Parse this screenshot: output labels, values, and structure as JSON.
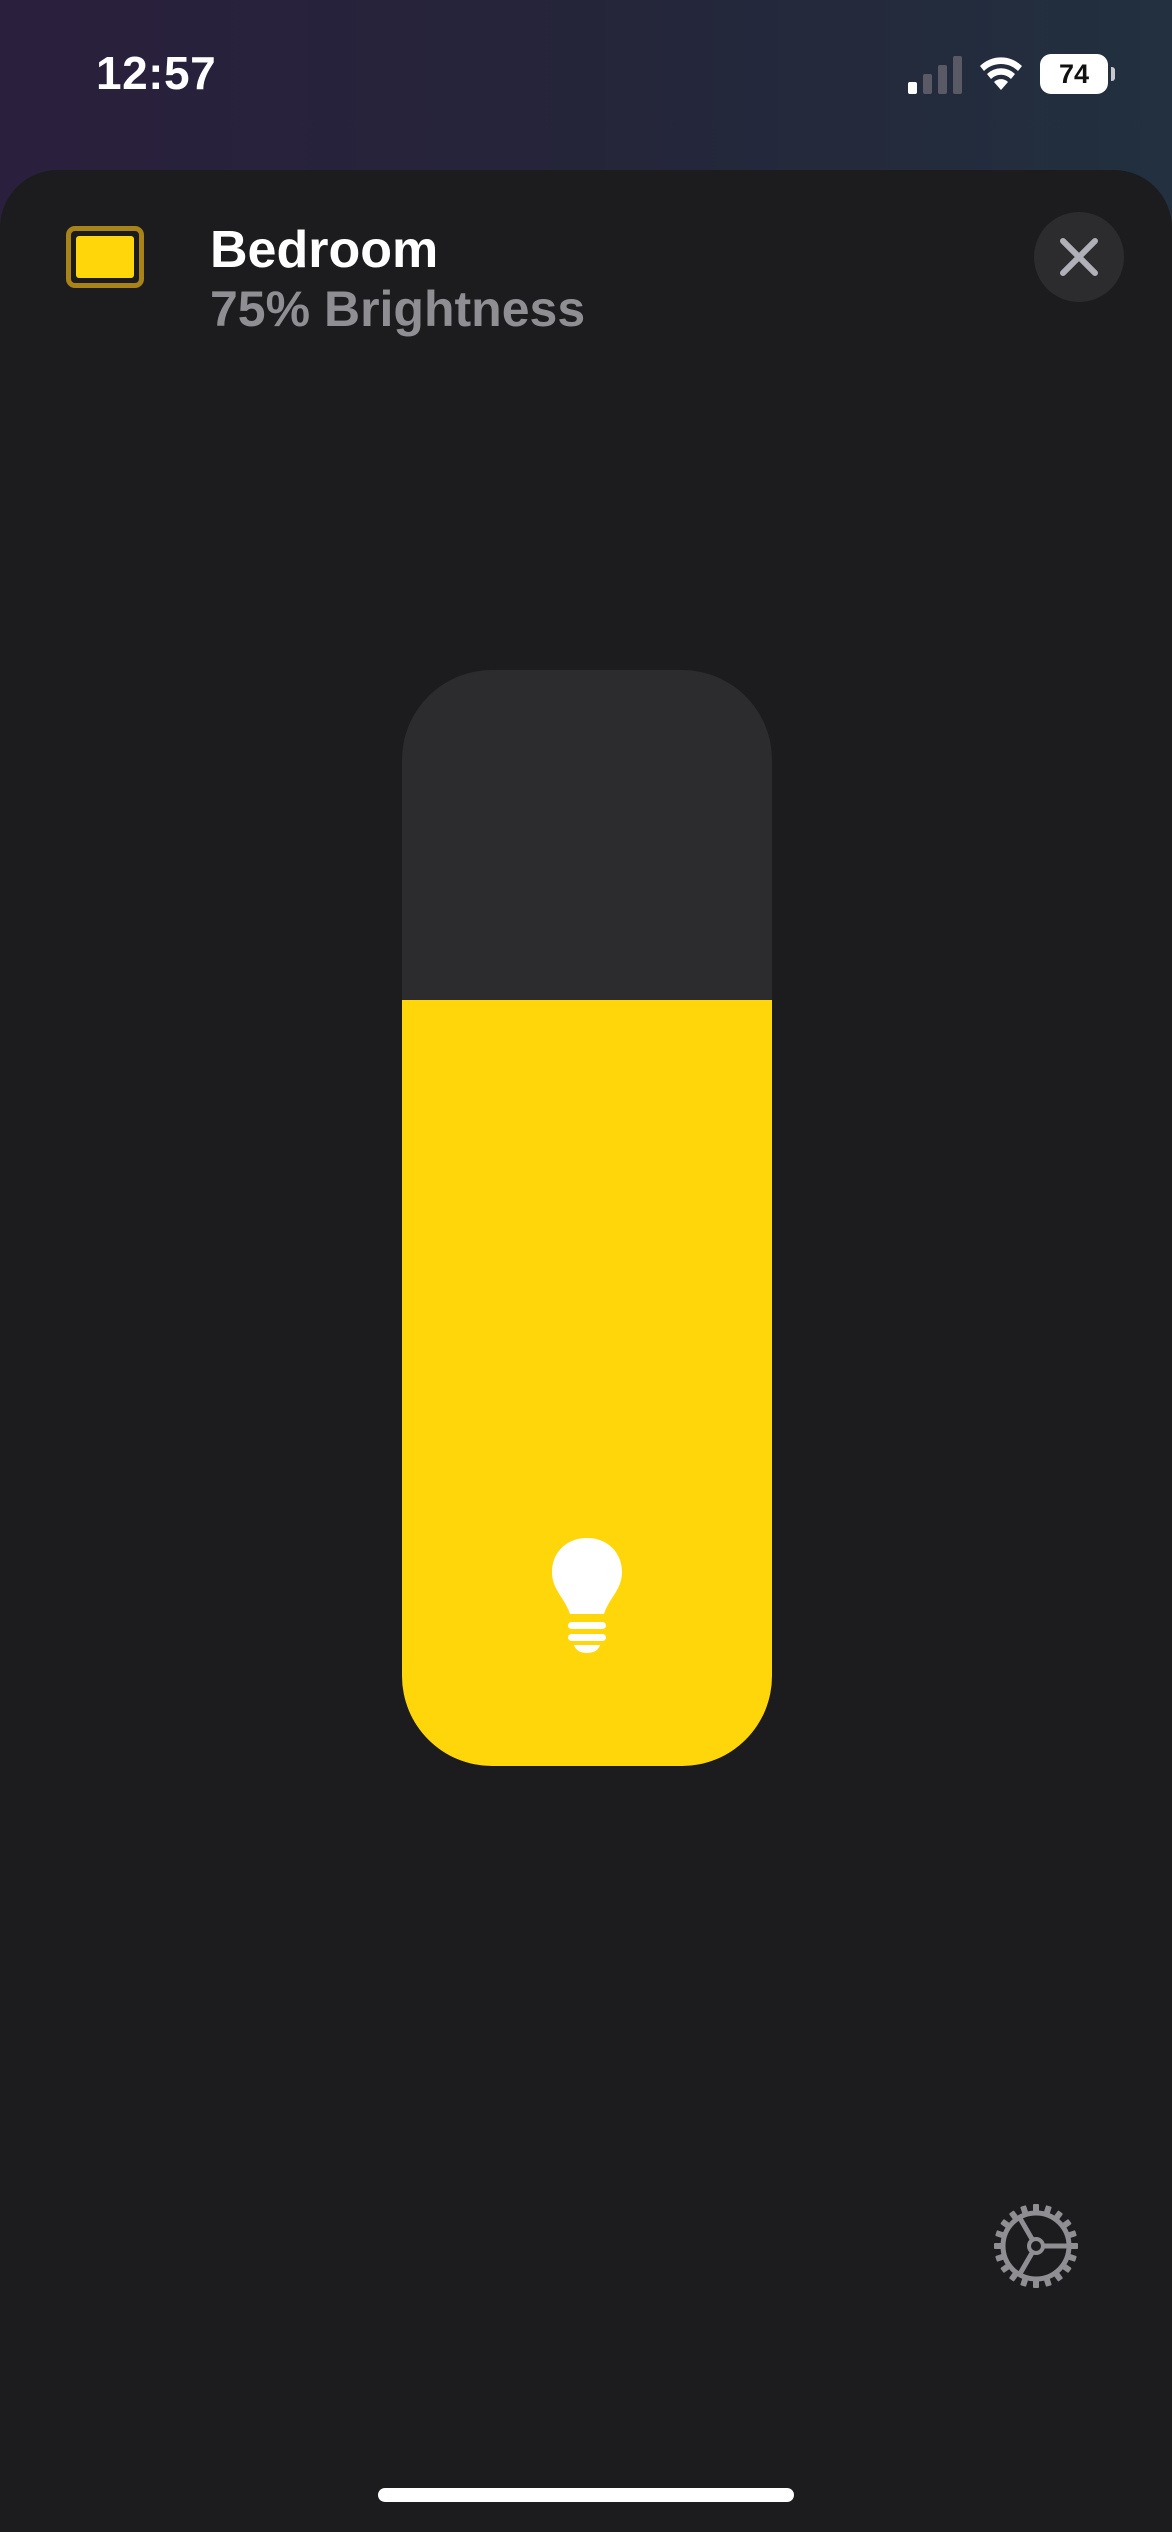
{
  "status_bar": {
    "time": "12:57",
    "battery_level": "74",
    "signal_bars_active": 1,
    "signal_bars_total": 4,
    "icons": [
      "cellular-signal-icon",
      "wifi-icon",
      "battery-icon"
    ]
  },
  "header": {
    "title": "Bedroom",
    "subtitle": "75% Brightness",
    "device_icon": "light-panel-icon",
    "close_icon": "close-icon"
  },
  "brightness": {
    "level_percent": 75,
    "slider_icon": "lightbulb-icon"
  },
  "footer": {
    "settings_icon": "gear-icon"
  },
  "colors": {
    "accent": "#ffd60a",
    "sheet_background": "#1c1c1e",
    "track": "#2c2c2e",
    "secondary_text": "#8e8e93"
  }
}
